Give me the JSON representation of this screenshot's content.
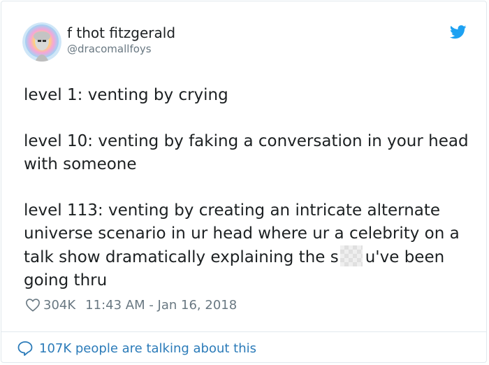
{
  "author": {
    "display_name": "f thot fitzgerald",
    "handle": "@dracomallfoys"
  },
  "icons": {
    "brand": "twitter-bird-icon",
    "like": "heart-icon",
    "conversation": "speech-bubble-icon"
  },
  "colors": {
    "brand_blue": "#1da1f2",
    "link_blue": "#2b7bb9",
    "text": "#1c2022",
    "muted": "#697882"
  },
  "tweet": {
    "line1": "level 1: venting by crying",
    "line2": "level 10: venting by faking a conversation in your head with someone",
    "line3_before_censor": "level 113: venting by creating an intricate alternate universe scenario in ur head where ur a celebrity on a talk show dramatically explaining the s",
    "line3_after_censor": "u've been going thru"
  },
  "meta": {
    "likes": "304K",
    "timestamp": "11:43 AM - Jan 16, 2018"
  },
  "footer": {
    "talking_text": "107K people are talking about this"
  }
}
